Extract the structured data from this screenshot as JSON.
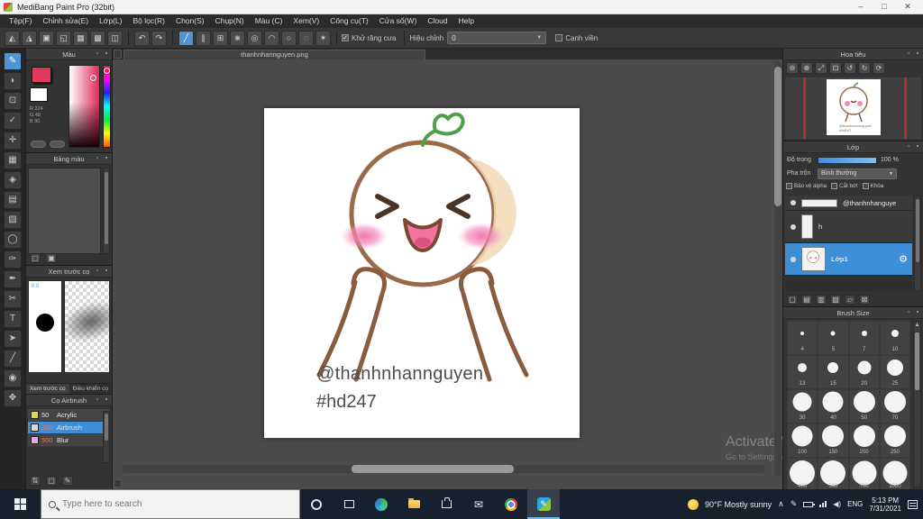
{
  "window": {
    "title": "MediBang Paint Pro (32bit)"
  },
  "menu": {
    "items": [
      "Tệp(F)",
      "Chỉnh sửa(E)",
      "Lớp(L)",
      "Bộ lọc(R)",
      "Chọn(S)",
      "Chụp(N)",
      "Màu (C)",
      "Xem(V)",
      "Công cụ(T)",
      "Cửa sổ(W)",
      "Cloud",
      "Help"
    ]
  },
  "toolbar": {
    "antialias_label": "Khử răng cưa",
    "correction_label": "Hiệu chỉnh",
    "correction_value": "0",
    "edge_label": "Cạnh viền"
  },
  "panels": {
    "color": {
      "title": "Màu",
      "fg_color": "#e23a5e",
      "bg_color": "#ffffff",
      "readout": [
        "R 224",
        "G 48",
        "B 90"
      ]
    },
    "palette": {
      "title": "Bảng màu"
    },
    "preview": {
      "title": "Xem trước cọ",
      "size_label": "8.0",
      "tab_left": "Xem trước cọ",
      "tab_right": "Điều khiển cọ"
    },
    "brushes": {
      "title": "Cọ Airbrush",
      "items": [
        {
          "size": "50",
          "name": "Acrylic",
          "swatch": "#e8d44d"
        },
        {
          "size": "100",
          "name": "Airbrush",
          "swatch": "#d9d9d9"
        },
        {
          "size": "500",
          "name": "Blur",
          "swatch": "#eba6e6"
        }
      ]
    },
    "navigator": {
      "title": "Hoa tiêu"
    },
    "layer": {
      "title": "Lớp",
      "opacity_label": "Độ trong",
      "opacity_value": "100 %",
      "blend_label": "Pha trộn",
      "blend_value": "Bình thường",
      "checkbox1": "Bảo vệ alpha",
      "checkbox2": "Cắt bớt",
      "checkbox3": "Khóa",
      "layers": [
        {
          "name": "@thanhnhanguye"
        },
        {
          "name": "h"
        },
        {
          "name": "Lớp1"
        }
      ]
    },
    "brush_size": {
      "title": "Brush Size",
      "values": [
        "4",
        "5",
        "7",
        "10",
        "13",
        "15",
        "20",
        "25",
        "30",
        "40",
        "50",
        "70",
        "100",
        "150",
        "200",
        "250",
        "400",
        "500",
        "700",
        "1000"
      ]
    }
  },
  "canvas": {
    "doc_tab": "thanhnhannguyen.png",
    "caption_line1": "@thanhnhannguyen",
    "caption_line2": "#hd247"
  },
  "watermark": {
    "line1": "Activate Windows",
    "line2": "Go to Settings to activate Windows."
  },
  "taskbar": {
    "search_placeholder": "Type here to search",
    "weather": "90°F Mostly sunny",
    "language": "ENG",
    "time": "5:13 PM",
    "date": "7/31/2021"
  }
}
